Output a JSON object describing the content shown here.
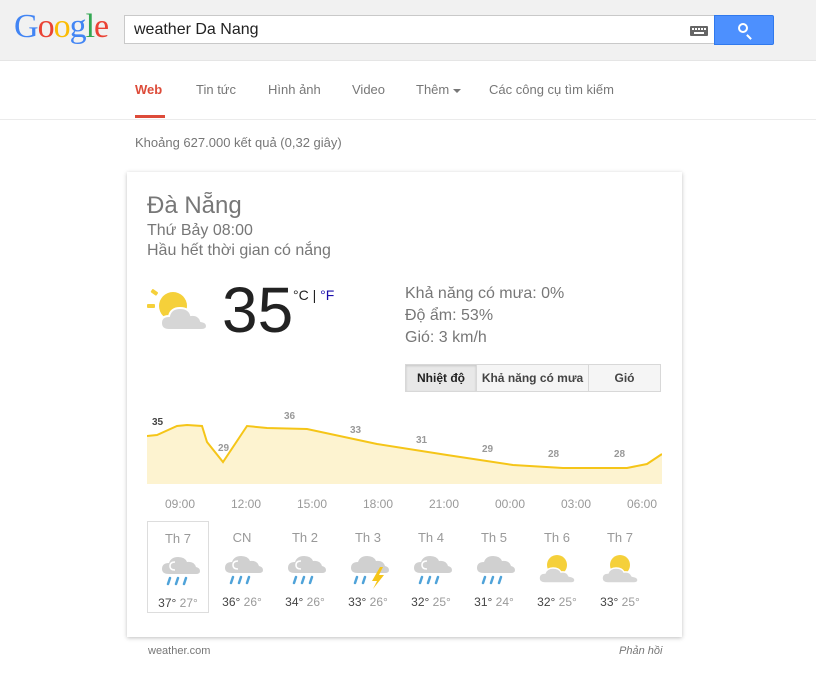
{
  "logo": {
    "letters": [
      "G",
      "o",
      "o",
      "g",
      "l",
      "e"
    ],
    "colors": [
      "#4285f4",
      "#ea4335",
      "#fbbc05",
      "#4285f4",
      "#34a853",
      "#ea4335"
    ]
  },
  "search": {
    "query": "weather Da Nang"
  },
  "nav": {
    "web": "Web",
    "news": "Tin tức",
    "images": "Hình ảnh",
    "video": "Video",
    "more": "Thêm",
    "tools": "Các công cụ tìm kiếm"
  },
  "result_stats": "Khoảng 627.000 kết quả (0,32 giây)",
  "weather": {
    "city": "Đà Nẵng",
    "time": "Thứ Bảy 08:00",
    "condition": "Hầu hết thời gian có nắng",
    "temp": "35",
    "unit_c": "°C",
    "unit_sep": " | ",
    "unit_f": "°F",
    "precip": "Khả năng có mưa: 0%",
    "humidity": "Độ ẩm: 53%",
    "wind": "Gió: 3 km/h",
    "tabs": [
      "Nhiệt độ",
      "Khả năng có mưa",
      "Gió"
    ],
    "hours": [
      "09:00",
      "12:00",
      "15:00",
      "18:00",
      "21:00",
      "00:00",
      "03:00",
      "06:00"
    ],
    "hourly_temps": [
      "35",
      "29",
      "36",
      "33",
      "31",
      "29",
      "28",
      "28"
    ],
    "days": [
      {
        "name": "Th 7",
        "hi": "37°",
        "lo": "27°",
        "icon": "partly-cloudy-rain-icon"
      },
      {
        "name": "CN",
        "hi": "36°",
        "lo": "26°",
        "icon": "partly-cloudy-rain-icon"
      },
      {
        "name": "Th 2",
        "hi": "34°",
        "lo": "26°",
        "icon": "partly-cloudy-rain-icon"
      },
      {
        "name": "Th 3",
        "hi": "33°",
        "lo": "26°",
        "icon": "thunderstorm-icon"
      },
      {
        "name": "Th 4",
        "hi": "32°",
        "lo": "25°",
        "icon": "partly-cloudy-rain-icon"
      },
      {
        "name": "Th 5",
        "hi": "31°",
        "lo": "24°",
        "icon": "rain-icon"
      },
      {
        "name": "Th 6",
        "hi": "32°",
        "lo": "25°",
        "icon": "partly-sunny-icon"
      },
      {
        "name": "Th 7",
        "hi": "33°",
        "lo": "25°",
        "icon": "partly-sunny-icon"
      }
    ]
  },
  "source": "weather.com",
  "feedback": "Phản hồi",
  "colors": {
    "chart_line": "#f5c518",
    "chart_fill": "#fdf3d0",
    "sun": "#f5d03a",
    "cloud": "#d0d0d0",
    "rain": "#4fa3d9"
  }
}
